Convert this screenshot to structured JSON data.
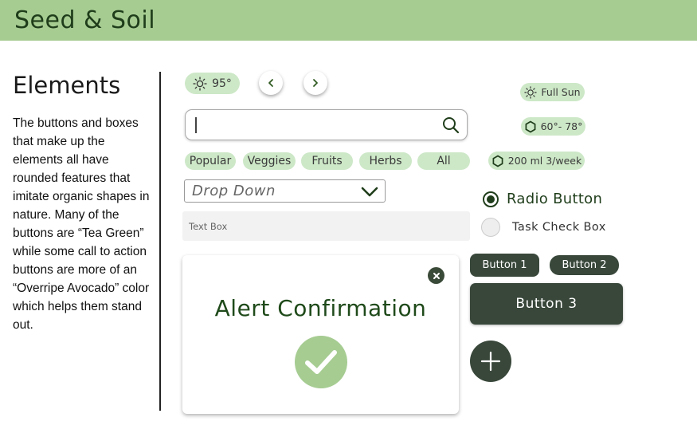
{
  "header": {
    "brand": "Seed & Soil"
  },
  "intro": {
    "title": "Elements",
    "description": "The buttons and boxes that make up the elements all have rounded features that imitate organic shapes in nature. Many of the buttons are “Tea Green” while some call to action buttons are more of an “Overripe Avocado” color which helps them stand out."
  },
  "weather": {
    "temperature": "95°",
    "icon": "sun-icon"
  },
  "navigation": {
    "prev_icon": "chevron-left-icon",
    "next_icon": "chevron-right-icon"
  },
  "search": {
    "value": "",
    "icon": "search-icon"
  },
  "filters": [
    "Popular",
    "Veggies",
    "Fruits",
    "Herbs",
    "All"
  ],
  "dropdown": {
    "selected": "Drop Down",
    "icon": "chevron-down-icon"
  },
  "textbox": {
    "placeholder": "Text Box"
  },
  "alert": {
    "title": "Alert Confirmation",
    "close_icon": "close-icon",
    "check_icon": "checkmark-icon"
  },
  "plant_info": {
    "sun": "Full Sun",
    "temperature_range": "60°- 78°",
    "water": "200 ml 3/week"
  },
  "radio": {
    "label": "Radio Button",
    "selected": true
  },
  "checkbox": {
    "label": "Task Check Box",
    "checked": false
  },
  "buttons": {
    "button1": "Button 1",
    "button2": "Button 2",
    "button3": "Button 3",
    "fab_icon": "plus-icon"
  },
  "colors": {
    "tea_green": "#cde8c7",
    "header_green": "#a6cc92",
    "overripe_avocado": "#38473a",
    "text_dark_green": "#1f3d1a"
  }
}
